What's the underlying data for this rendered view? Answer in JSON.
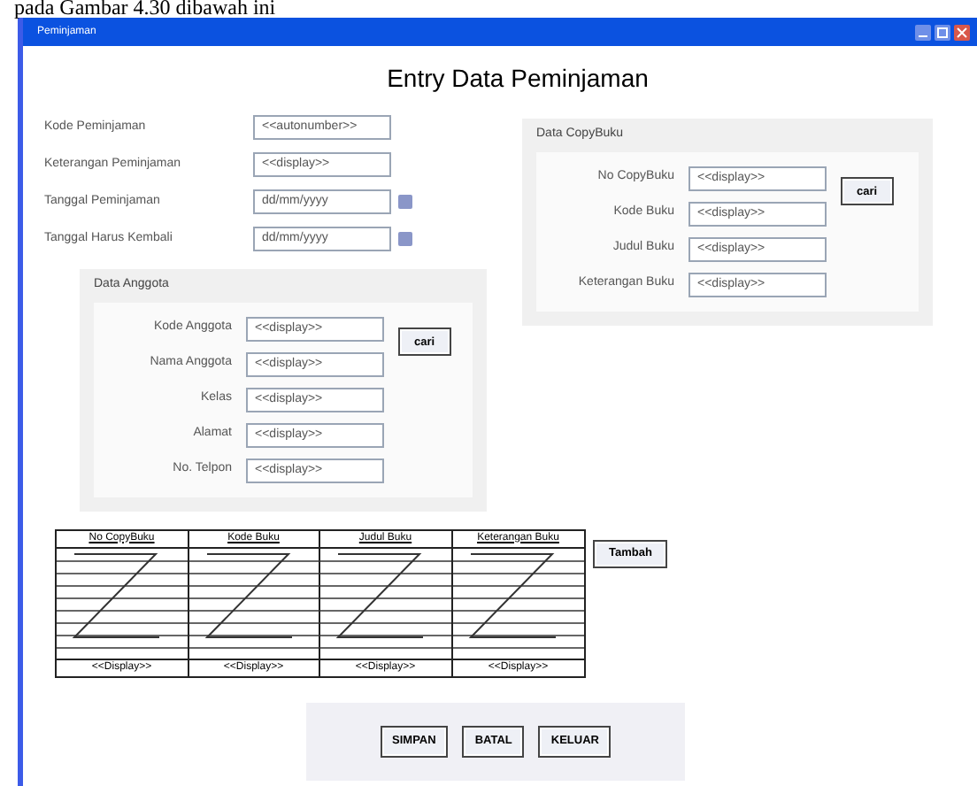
{
  "caption": "pada Gambar 4.30 dibawah ini",
  "window": {
    "title": "Peminjaman",
    "heading": "Entry Data Peminjaman"
  },
  "main_fields": [
    {
      "label": "Kode Peminjaman",
      "value": "<<autonumber>>",
      "kind": "text"
    },
    {
      "label": "Keterangan Peminjaman",
      "value": "<<display>>",
      "kind": "text"
    },
    {
      "label": "Tanggal Peminjaman",
      "value": "dd/mm/yyyy",
      "kind": "date"
    },
    {
      "label": "Tanggal Harus Kembali",
      "value": "dd/mm/yyyy",
      "kind": "date"
    }
  ],
  "anggota": {
    "title": "Data Anggota",
    "button": "cari",
    "fields": [
      {
        "label": "Kode Anggota",
        "value": "<<display>>"
      },
      {
        "label": "Nama Anggota",
        "value": "<<display>>"
      },
      {
        "label": "Kelas",
        "value": "<<display>>"
      },
      {
        "label": "Alamat",
        "value": "<<display>>"
      },
      {
        "label": "No. Telpon",
        "value": "<<display>>"
      }
    ]
  },
  "copybuku": {
    "title": "Data CopyBuku",
    "button": "cari",
    "fields": [
      {
        "label": "No CopyBuku",
        "value": "<<display>>"
      },
      {
        "label": "Kode Buku",
        "value": "<<display>>"
      },
      {
        "label": "Judul Buku",
        "value": "<<display>>"
      },
      {
        "label": "Keterangan Buku",
        "value": "<<display>>"
      }
    ]
  },
  "table": {
    "columns": [
      {
        "header": "No CopyBuku",
        "footer": "<<Display>>"
      },
      {
        "header": "Kode Buku",
        "footer": "<<Display>>"
      },
      {
        "header": "Judul Buku",
        "footer": "<<Display>>"
      },
      {
        "header": "Keterangan Buku",
        "footer": "<<Display>>"
      }
    ],
    "button": "Tambah"
  },
  "buttons": [
    "SIMPAN",
    "BATAL",
    "KELUAR"
  ]
}
